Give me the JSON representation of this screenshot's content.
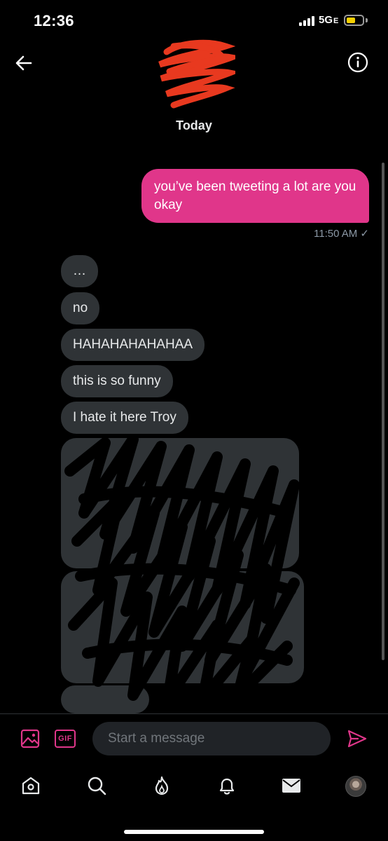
{
  "status_bar": {
    "time": "12:36",
    "network": "5G",
    "network_suffix": "E"
  },
  "header": {
    "date_label": "Today"
  },
  "messages": {
    "outgoing": {
      "text": "you’ve been tweeting a lot are you okay",
      "timestamp": "11:50 AM ✓"
    },
    "incoming": [
      "…",
      "no",
      "HAHAHAHAHAHAA",
      "this is so funny",
      "I hate it here Troy"
    ]
  },
  "composer": {
    "placeholder": "Start a message",
    "gif_label": "GIF"
  },
  "colors": {
    "accent": "#e0368a",
    "bubble_in": "#2f3336",
    "redaction": "#e8391f"
  },
  "icons": {
    "back": "arrow-left-icon",
    "info": "info-icon",
    "media": "image-icon",
    "gif": "gif-icon",
    "send": "send-icon",
    "home": "home-icon",
    "search": "search-icon",
    "spaces": "flame-icon",
    "notifications": "bell-icon",
    "messages": "envelope-icon"
  }
}
